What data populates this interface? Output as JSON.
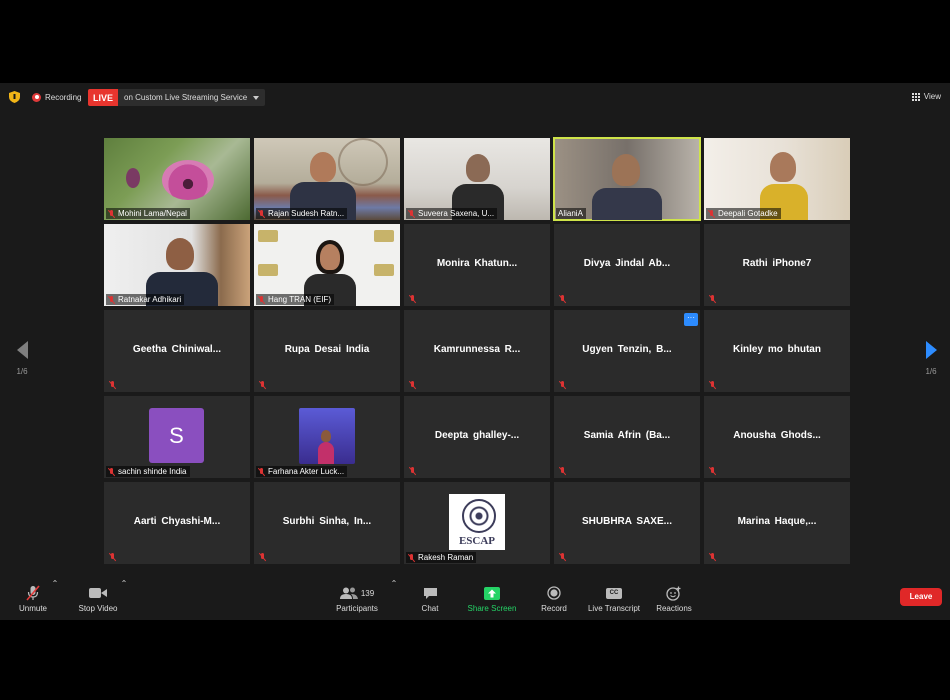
{
  "topbar": {
    "recording_label": "Recording",
    "live_badge": "LIVE",
    "live_text": "on Custom Live Streaming Service",
    "view_label": "View"
  },
  "nav": {
    "left_page": "1/6",
    "right_page": "1/6"
  },
  "tiles": [
    {
      "name": "Mohini Lama/Nepal",
      "video": true
    },
    {
      "name": "Rajan Sudesh Ratn...",
      "video": true
    },
    {
      "name": "Suveera Saxena, U...",
      "video": true
    },
    {
      "name": "AlianiA",
      "video": true,
      "active": true
    },
    {
      "name": "Deepali Gotadke",
      "video": true
    },
    {
      "name": "Ratnakar Adhikari",
      "video": true
    },
    {
      "name": "Hang TRAN (EIF)",
      "video": true
    },
    {
      "name": "Monira  Khatun...",
      "video": false
    },
    {
      "name": "Divya  Jindal  Ab...",
      "video": false
    },
    {
      "name": "Rathi iPhone7",
      "video": false
    },
    {
      "name": "Geetha  Chiniwal...",
      "video": false
    },
    {
      "name": "Rupa Desai India",
      "video": false
    },
    {
      "name": "Kamrunnessa  R...",
      "video": false
    },
    {
      "name": "Ugyen  Tenzin,  B...",
      "video": false,
      "more": "···"
    },
    {
      "name": "Kinley mo bhutan",
      "video": false
    },
    {
      "name": "sachin shinde India",
      "video": false,
      "avatar_letter": "S"
    },
    {
      "name": "Farhana Akter Luck...",
      "video": false
    },
    {
      "name": "Deepta  ghalley-...",
      "video": false
    },
    {
      "name": "Samia  Afrin  (Ba...",
      "video": false
    },
    {
      "name": "Anousha  Ghods...",
      "video": false
    },
    {
      "name": "Aarti  Chyashi-M...",
      "video": false
    },
    {
      "name": "Surbhi  Sinha,  In...",
      "video": false
    },
    {
      "name": "Rakesh Raman",
      "video": false,
      "logo_text": "ESCAP"
    },
    {
      "name": "SHUBHRA  SAXE...",
      "video": false
    },
    {
      "name": "Marina  Haque,...",
      "video": false
    }
  ],
  "toolbar": {
    "unmute": "Unmute",
    "stop_video": "Stop Video",
    "participants": "Participants",
    "participants_count": "139",
    "chat": "Chat",
    "share_screen": "Share Screen",
    "record": "Record",
    "live_transcript": "Live Transcript",
    "cc_badge": "CC",
    "reactions": "Reactions",
    "leave": "Leave"
  },
  "colors": {
    "accent": "#2d8cff",
    "live_red": "#e8352e",
    "leave_red": "#e02828",
    "active_border": "#cfe44a",
    "share_green": "#25d366"
  }
}
